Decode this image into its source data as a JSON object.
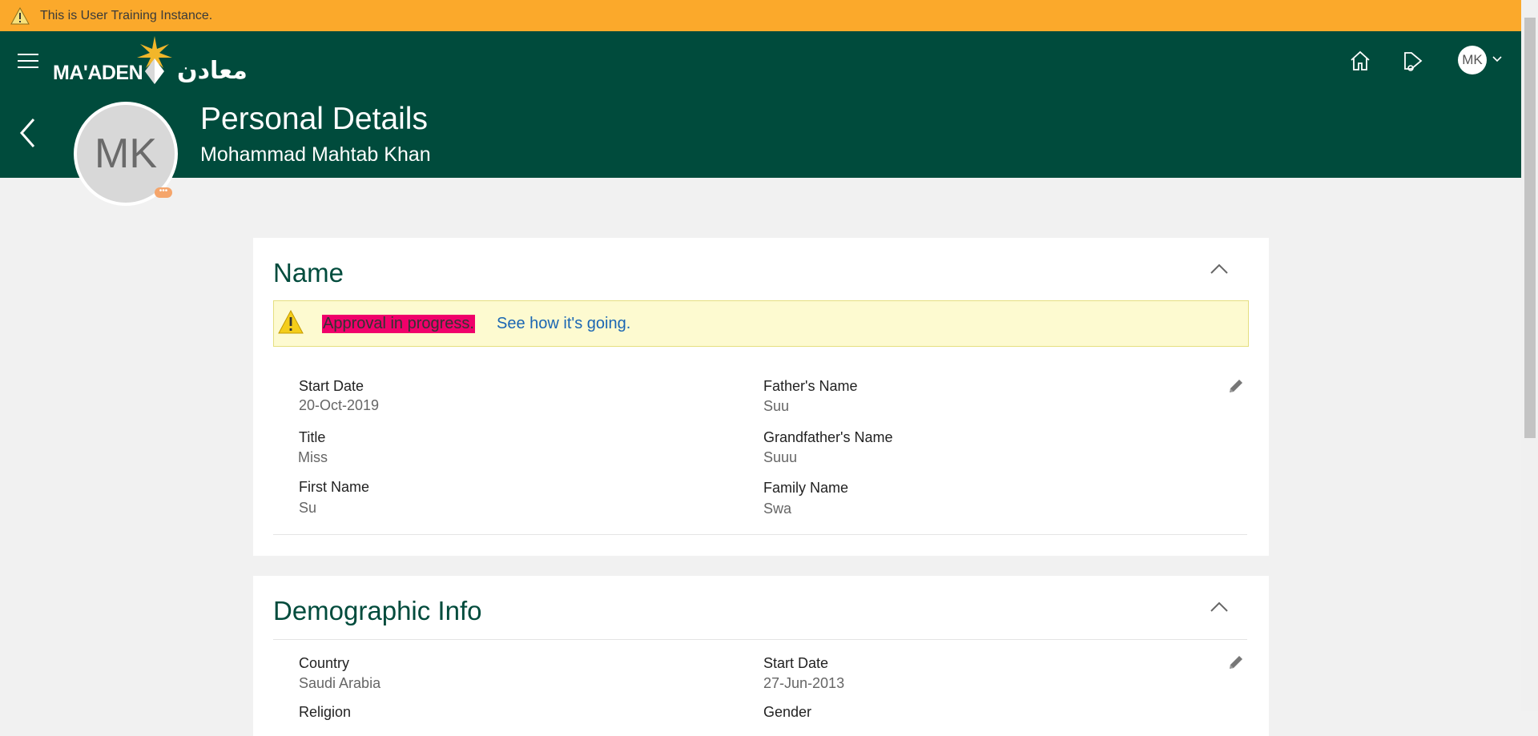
{
  "banner": {
    "text": "This is User Training Instance."
  },
  "header": {
    "logo_text": "MA'ADEN",
    "logo_arabic": "معادن",
    "user_initials": "MK"
  },
  "page": {
    "title": "Personal Details",
    "subtitle": "Mohammad Mahtab Khan",
    "avatar_initials": "MK",
    "avatar_more": "•••"
  },
  "name_section": {
    "title": "Name",
    "alert_highlight": "Approval in progress.",
    "alert_link": "See how it's going.",
    "fields": {
      "start_date": {
        "label": "Start Date",
        "value": "20-Oct-2019"
      },
      "title": {
        "label": "Title",
        "value": "Miss"
      },
      "first_name": {
        "label": "First Name",
        "value": "Su"
      },
      "fathers_name": {
        "label": "Father's Name",
        "value": "Suu"
      },
      "grandfathers_name": {
        "label": "Grandfather's Name",
        "value": "Suuu"
      },
      "family_name": {
        "label": "Family Name",
        "value": "Swa"
      }
    }
  },
  "demographic_section": {
    "title": "Demographic Info",
    "fields": {
      "country": {
        "label": "Country",
        "value": "Saudi Arabia"
      },
      "start_date": {
        "label": "Start Date",
        "value": "27-Jun-2013"
      },
      "religion": {
        "label": "Religion"
      },
      "gender": {
        "label": "Gender"
      }
    }
  },
  "colors": {
    "banner": "#fba92b",
    "header": "#004b3c",
    "highlight": "#f0006a",
    "link": "#1a66b3",
    "alert_bg": "#fdfad0"
  }
}
